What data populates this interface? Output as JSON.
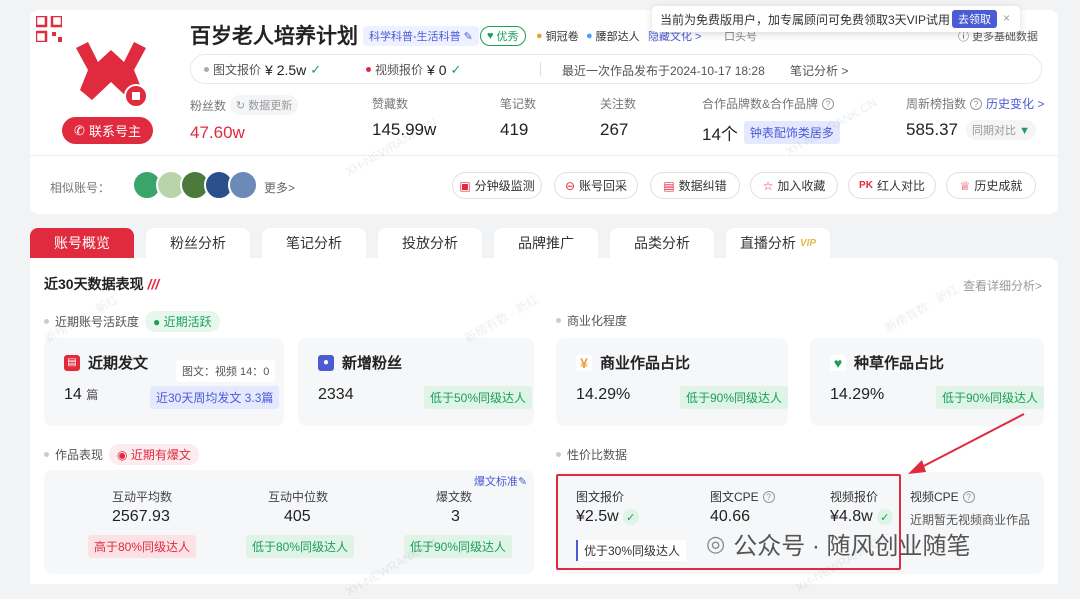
{
  "popup": {
    "text": "当前为免费版用户，加专属顾问可免费领取3天VIP试用",
    "button": "去领取",
    "close": "×"
  },
  "profile": {
    "title": "百岁老人培养计划",
    "category_tag": "科学科普-生活科普",
    "quality_tag": "优秀",
    "tag_copper": "铜冠卷",
    "tag_expert": "腰部达人",
    "tag_hidden1": "隐藏文化 >",
    "tag_hidden2": "口头号",
    "more_data": "更多基础数据",
    "contact_button": "联系号主",
    "image_price_label": "图文报价",
    "image_price_value": "¥ 2.5w",
    "video_price_label": "视频报价",
    "video_price_value": "¥ 0",
    "last_post_label": "最近一次作品发布于2024-10-17 18:28",
    "note_analysis": "笔记分析 >"
  },
  "stats": {
    "fans_label": "粉丝数",
    "refresh": "数据更新",
    "fans_value": "47.60w",
    "likes_label": "赞藏数",
    "likes_value": "145.99w",
    "notes_label": "笔记数",
    "notes_value": "419",
    "follow_label": "关注数",
    "follow_value": "267",
    "brand_label": "合作品牌数&合作品牌",
    "brand_value": "14个",
    "brand_tag": "钟表配饰类居多",
    "rank_label": "周新榜指数",
    "rank_change": "历史变化 >",
    "rank_value": "585.37",
    "rank_compare": "同期对比"
  },
  "similar": {
    "label": "相似账号：",
    "more": "更多>",
    "avatars": [
      {
        "color": "#3aa56a"
      },
      {
        "color": "#b8d4a8"
      },
      {
        "color": "#4b7a3c"
      },
      {
        "color": "#2a4f8a"
      },
      {
        "color": "#6b8ab8"
      }
    ]
  },
  "actions": [
    {
      "icon": "monitor-icon",
      "label": "分钟级监测"
    },
    {
      "icon": "backtrack-icon",
      "label": "账号回采"
    },
    {
      "icon": "correct-icon",
      "label": "数据纠错"
    },
    {
      "icon": "star-icon",
      "label": "加入收藏"
    },
    {
      "icon": "pk-icon",
      "label": "红人对比"
    },
    {
      "icon": "trophy-icon",
      "label": "历史成就"
    }
  ],
  "tabs": [
    "账号概览",
    "粉丝分析",
    "笔记分析",
    "投放分析",
    "品牌推广",
    "品类分析",
    "直播分析"
  ],
  "vip": "VIP",
  "section": {
    "title": "近30天数据表现",
    "detail": "查看详细分析>"
  },
  "activity": {
    "label": "近期账号活跃度",
    "badge": "近期活跃"
  },
  "commercial": {
    "label": "商业化程度"
  },
  "recent_post": {
    "title": "近期发文",
    "ratio": "图文：视频 14：0",
    "value": "14",
    "unit": "篇",
    "badge": "近30天周均发文 3.3篇"
  },
  "new_fans": {
    "title": "新增粉丝",
    "value": "2334",
    "badge": "低于50%同级达人"
  },
  "biz_ratio": {
    "title": "商业作品占比",
    "value": "14.29%",
    "badge": "低于90%同级达人"
  },
  "seed_ratio": {
    "title": "种草作品占比",
    "value": "14.29%",
    "badge": "低于90%同级达人"
  },
  "performance": {
    "label": "作品表现",
    "badge": "近期有爆文",
    "standard": "爆文标准",
    "items": [
      {
        "label": "互动平均数",
        "value": "2567.93",
        "badge": "高于80%同级达人",
        "type": "red"
      },
      {
        "label": "互动中位数",
        "value": "405",
        "badge": "低于80%同级达人",
        "type": "green"
      },
      {
        "label": "爆文数",
        "value": "3",
        "badge": "低于90%同级达人",
        "type": "green"
      }
    ]
  },
  "value_data": {
    "label": "性价比数据",
    "image_price_label": "图文报价",
    "image_price_value": "¥2.5w",
    "image_price_badge": "优于30%同级达人",
    "image_cpe_label": "图文CPE",
    "image_cpe_value": "40.66",
    "video_price_label": "视频报价",
    "video_price_value": "¥4.8w",
    "video_cpe_label": "视频CPE",
    "video_cpe_value": "近期暂无视频商业作品"
  },
  "watermark": {
    "text1": "XH-NEWRANK.CN",
    "text2": "新榜有数 · 新红"
  },
  "wechat": "公众号 · 随风创业随笔"
}
